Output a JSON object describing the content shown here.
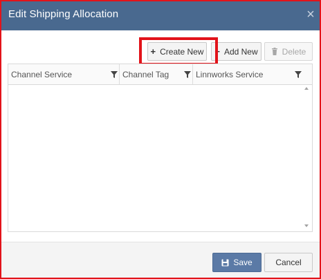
{
  "dialog": {
    "title": "Edit Shipping Allocation",
    "close_glyph": "×"
  },
  "toolbar": {
    "create_new_label": "Create New",
    "add_new_label": "Add New",
    "delete_label": "Delete",
    "plus_glyph": "+",
    "create_new_highlighted": true,
    "delete_disabled": true
  },
  "grid": {
    "columns": [
      {
        "label": "Channel Service",
        "filter_icon": "filter-icon"
      },
      {
        "label": "Channel Tag",
        "filter_icon": "filter-icon"
      },
      {
        "label": "Linnworks Service",
        "filter_icon": "filter-icon"
      }
    ],
    "rows": []
  },
  "footer": {
    "save_label": "Save",
    "cancel_label": "Cancel"
  },
  "colors": {
    "titlebar": "#49698f",
    "highlight": "#e2131a",
    "save_button": "#5b7aa6"
  }
}
